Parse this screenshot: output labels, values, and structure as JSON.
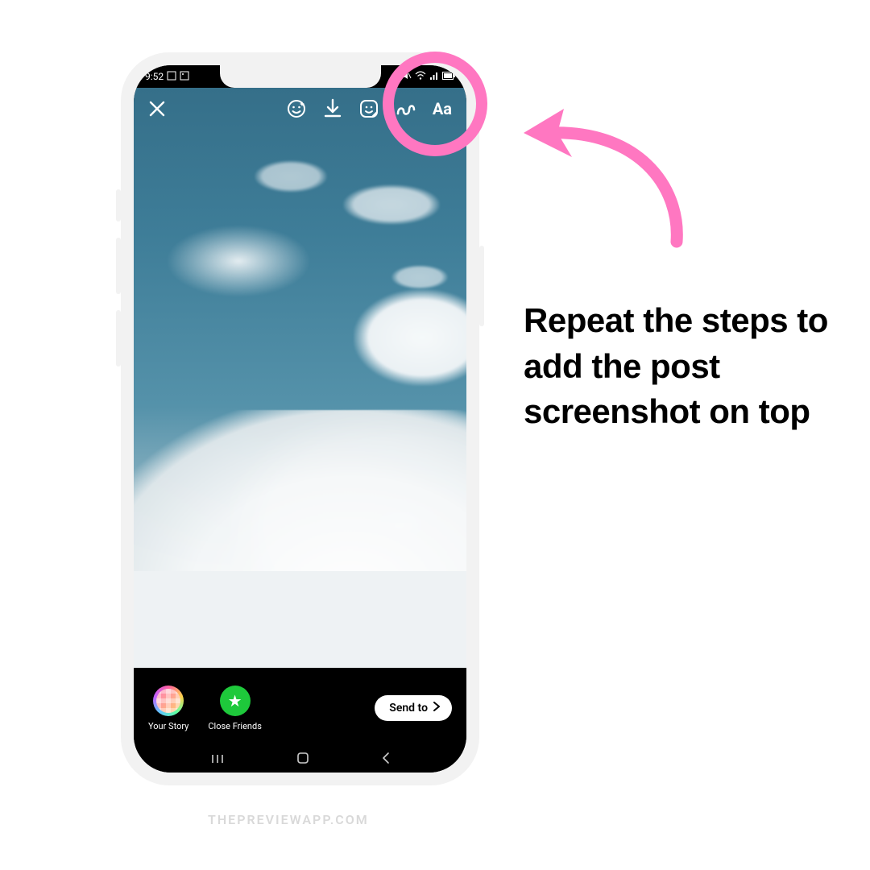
{
  "status": {
    "time": "9:52",
    "icons_left": [
      "screenshot-icon",
      "image-icon"
    ],
    "icons_right": [
      "mute-icon",
      "wifi-icon",
      "signal-icon",
      "battery-icon"
    ]
  },
  "editor_tools": {
    "close": "close-icon",
    "effects": "sparkle-face-icon",
    "download": "download-icon",
    "sticker": "sticker-icon",
    "draw": "squiggle-icon",
    "text_label": "Aa"
  },
  "share": {
    "your_story_label": "Your Story",
    "close_friends_label": "Close Friends",
    "send_label": "Send to",
    "close_friends_star": "★"
  },
  "nav": {
    "recents": "|||",
    "home": "◯",
    "back": "‹"
  },
  "instruction_text": "Repeat the steps to add the post screenshot on top",
  "watermark": "THEPREVIEWAPP.COM",
  "colors": {
    "pink": "#ff77c1"
  }
}
